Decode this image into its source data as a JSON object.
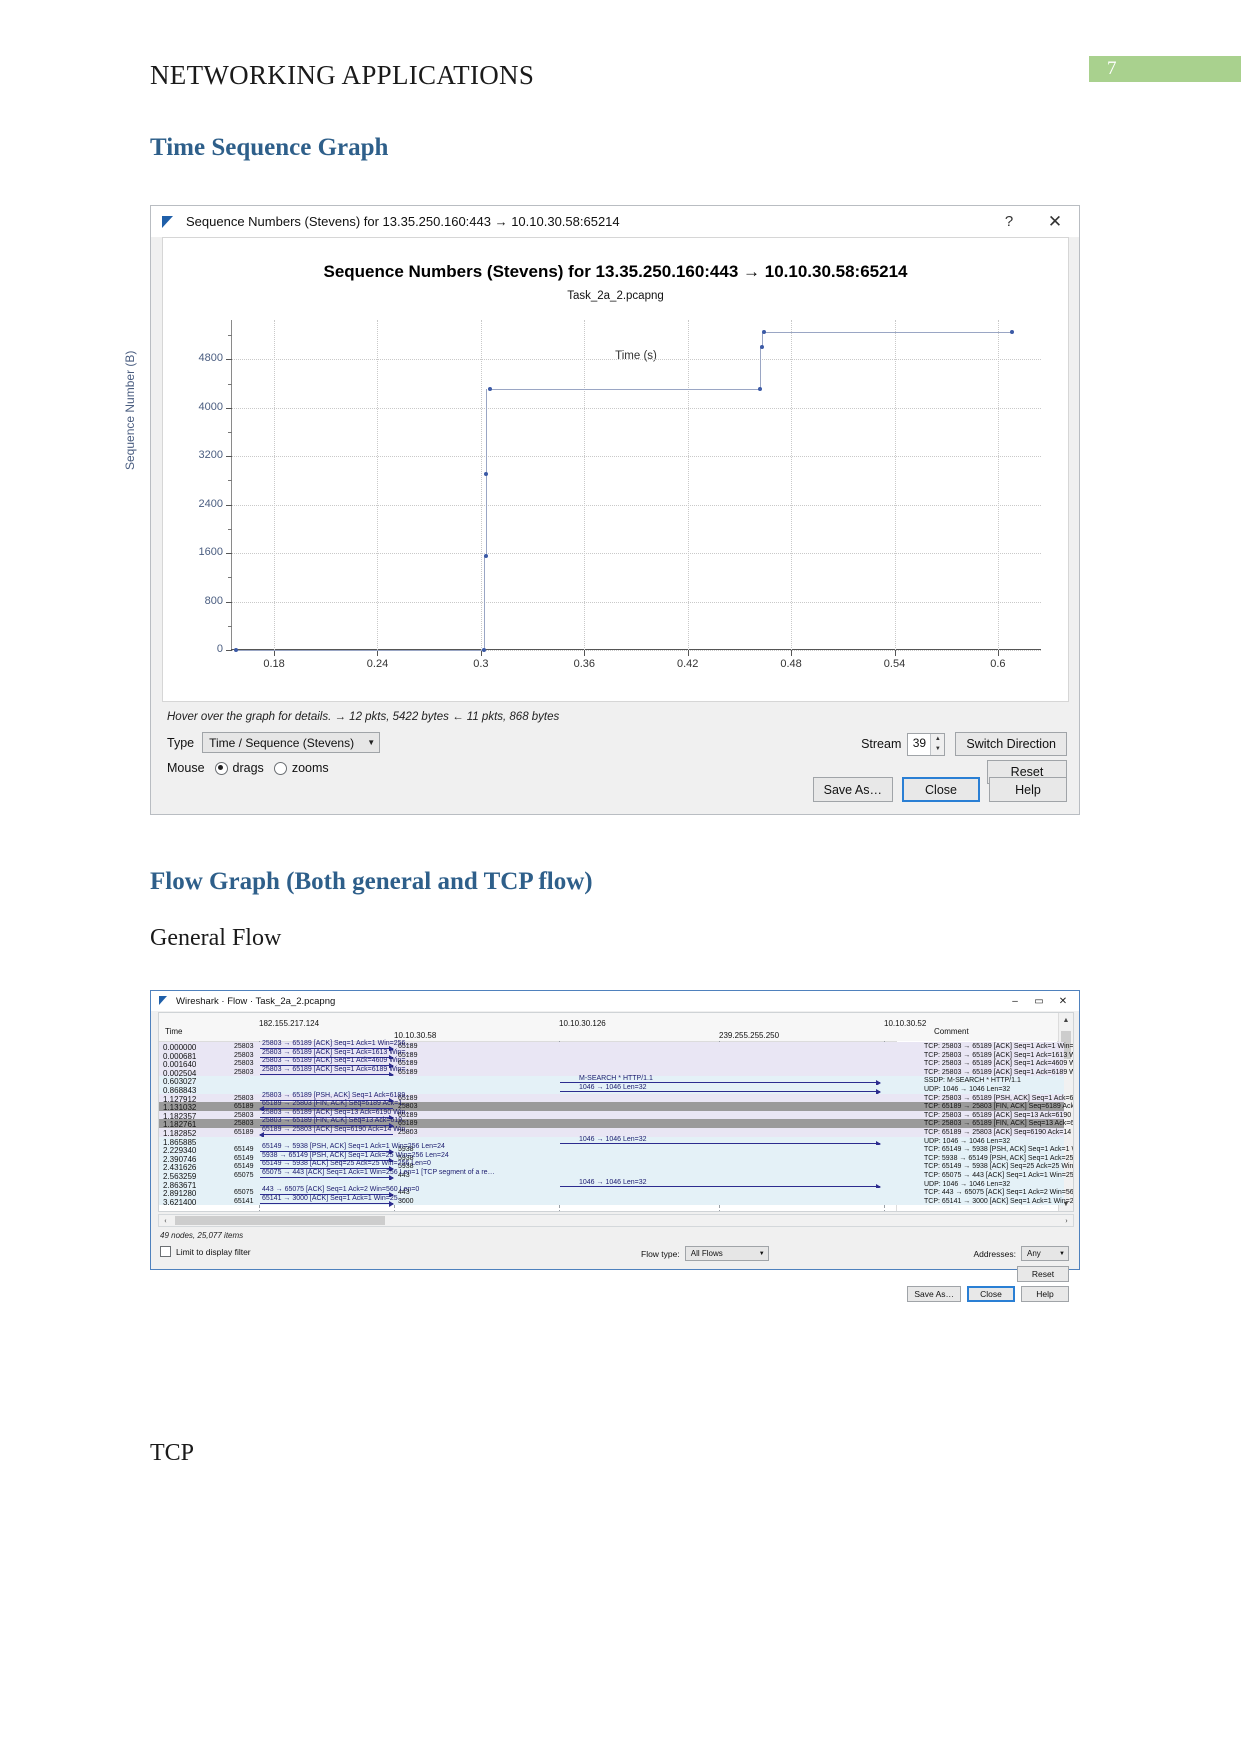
{
  "document": {
    "header_title": "NETWORKING APPLICATIONS",
    "page_number": "7",
    "page_badge_color": "#a9d18e",
    "heading_color": "#2e5f8a",
    "headings": {
      "time_sequence": "Time Sequence Graph",
      "flow_graph": "Flow Graph (Both general and TCP flow)",
      "general_flow": "General Flow",
      "tcp": "TCP"
    }
  },
  "sequence_window": {
    "title": "Sequence Numbers (Stevens) for 13.35.250.160:443 → 10.10.30.58:65214",
    "title_icon": "wireshark-fin-icon",
    "help_icon": "?",
    "close_icon": "✕",
    "chart_title": "Sequence Numbers (Stevens) for 13.35.250.160:443 → 10.10.30.58:65214",
    "chart_subtitle": "Task_2a_2.pcapng",
    "hint": "Hover over the graph for details. → 12 pkts, 5422 bytes ← 11 pkts, 868 bytes",
    "type_label": "Type",
    "type_value": "Time / Sequence (Stevens)",
    "mouse_label": "Mouse",
    "mouse_drags": "drags",
    "mouse_zooms": "zooms",
    "mouse_selected": "drags",
    "stream_label": "Stream",
    "stream_value": "39",
    "switch_direction": "Switch Direction",
    "reset": "Reset",
    "save_as": "Save As…",
    "close": "Close",
    "help": "Help"
  },
  "chart_data": {
    "type": "line",
    "title": "Sequence Numbers (Stevens) for 13.35.250.160:443 → 10.10.30.58:65214",
    "subtitle": "Task_2a_2.pcapng",
    "xlabel": "Time (s)",
    "ylabel": "Sequence Number (B)",
    "xlim": [
      0.155,
      0.625
    ],
    "ylim": [
      0,
      5450
    ],
    "xticks": [
      "0.18",
      "0.24",
      "0.3",
      "0.36",
      "0.42",
      "0.48",
      "0.54",
      "0.6"
    ],
    "xtick_values": [
      0.18,
      0.24,
      0.3,
      0.36,
      0.42,
      0.48,
      0.54,
      0.6
    ],
    "yticks": [
      "0",
      "800",
      "1600",
      "2400",
      "3200",
      "4000",
      "4800"
    ],
    "ytick_values": [
      0,
      800,
      1600,
      2400,
      3200,
      4000,
      4800
    ],
    "grid": true,
    "legend": "none",
    "series": [
      {
        "name": "Sequence numbers (Stevens)",
        "points": [
          {
            "x": 0.158,
            "y": 0
          },
          {
            "x": 0.302,
            "y": 0
          },
          {
            "x": 0.303,
            "y": 1553
          },
          {
            "x": 0.303,
            "y": 2900
          },
          {
            "x": 0.305,
            "y": 4313
          },
          {
            "x": 0.462,
            "y": 4313
          },
          {
            "x": 0.463,
            "y": 5000
          },
          {
            "x": 0.464,
            "y": 5255
          },
          {
            "x": 0.608,
            "y": 5255
          }
        ]
      }
    ]
  },
  "flow_window": {
    "title": "Wireshark · Flow · Task_2a_2.pcapng",
    "title_icon": "wireshark-fin-icon",
    "minimize_icon": "–",
    "maximize_icon": "▭",
    "close_icon": "✕",
    "columns": [
      "Time",
      "182.155.217.124",
      "10.10.30.58",
      "10.10.30.126",
      "239.255.255.250",
      "10.10.30.52",
      "Comment"
    ],
    "status": "49 nodes, 25,077 items",
    "limit_to_display_filter": "Limit to display filter",
    "flow_type_label": "Flow type:",
    "flow_type_value": "All Flows",
    "addresses_label": "Addresses:",
    "addresses_value": "Any",
    "reset": "Reset",
    "save_as": "Save As…",
    "close": "Close",
    "help": "Help",
    "rows": [
      {
        "time": "0.000000",
        "src_port": "25803",
        "dst_port": "65189",
        "label": "25803 → 65189 [ACK] Seq=1 Ack=1 Win=256…",
        "comment": "TCP: 25803 → 65189 [ACK] Seq=1 Ack=1 Win=2…",
        "band": "b1",
        "selected": false
      },
      {
        "time": "0.000681",
        "src_port": "25803",
        "dst_port": "65189",
        "label": "25803 → 65189 [ACK] Seq=1 Ack=1613 Win=…",
        "comment": "TCP: 25803 → 65189 [ACK] Seq=1 Ack=1613 Wi…",
        "band": "b1",
        "selected": false
      },
      {
        "time": "0.001640",
        "src_port": "25803",
        "dst_port": "65189",
        "label": "25803 → 65189 [ACK] Seq=1 Ack=4609 Win=…",
        "comment": "TCP: 25803 → 65189 [ACK] Seq=1 Ack=4609 Wi…",
        "band": "b1",
        "selected": false
      },
      {
        "time": "0.002504",
        "src_port": "25803",
        "dst_port": "65189",
        "label": "25803 → 65189 [ACK] Seq=1 Ack=6189 Win=…",
        "comment": "TCP: 25803 → 65189 [ACK] Seq=1 Ack=6189 Wi…",
        "band": "b1",
        "selected": false
      },
      {
        "time": "0.603027",
        "src_port": "",
        "dst_port": "",
        "label": "M-SEARCH * HTTP/1.1",
        "comment": "SSDP: M-SEARCH * HTTP/1.1",
        "band": "b2",
        "selected": false
      },
      {
        "time": "0.868843",
        "src_port": "",
        "dst_port": "",
        "label": "1046 → 1046 Len=32",
        "comment": "UDP: 1046 → 1046 Len=32",
        "band": "b2",
        "selected": false
      },
      {
        "time": "1.127912",
        "src_port": "25803",
        "dst_port": "65189",
        "label": "25803 → 65189 [PSH, ACK] Seq=1 Ack=6189…",
        "comment": "TCP: 25803 → 65189 [PSH, ACK] Seq=1 Ack=61…",
        "band": "b1",
        "selected": false
      },
      {
        "time": "1.131032",
        "src_port": "65189",
        "dst_port": "25803",
        "label": "65189 → 25803 [FIN, ACK] Seq=6189 Ack=1…",
        "comment": "TCP: 65189 → 25803 [FIN, ACK] Seq=6189 Ack…",
        "band": "b1",
        "selected": true
      },
      {
        "time": "1.182357",
        "src_port": "25803",
        "dst_port": "65189",
        "label": "25803 → 65189 [ACK] Seq=13 Ack=6190 Win…",
        "comment": "TCP: 25803 → 65189 [ACK] Seq=13 Ack=6190 W…",
        "band": "b1",
        "selected": false
      },
      {
        "time": "1.182761",
        "src_port": "25803",
        "dst_port": "65189",
        "label": "25803 → 65189 [FIN, ACK] Seq=13 Ack=619…",
        "comment": "TCP: 25803 → 65189 [FIN, ACK] Seq=13 Ack=6…",
        "band": "b1",
        "selected": true
      },
      {
        "time": "1.182852",
        "src_port": "65189",
        "dst_port": "25803",
        "label": "65189 → 25803 [ACK] Seq=6190 Ack=14 Win…",
        "comment": "TCP: 65189 → 25803 [ACK] Seq=6190 Ack=14 W…",
        "band": "b1",
        "selected": false
      },
      {
        "time": "1.865885",
        "src_port": "",
        "dst_port": "",
        "label": "1046 → 1046 Len=32",
        "comment": "UDP: 1046 → 1046 Len=32",
        "band": "b2",
        "selected": false
      },
      {
        "time": "2.229340",
        "src_port": "65149",
        "dst_port": "5938",
        "label": "65149 → 5938 [PSH, ACK] Seq=1 Ack=1 Win=256 Len=24",
        "comment": "TCP: 65149 → 5938 [PSH, ACK] Seq=1 Ack=1 W…",
        "band": "b2",
        "selected": false
      },
      {
        "time": "2.390746",
        "src_port": "65149",
        "dst_port": "5938",
        "label": "5938 → 65149 [PSH, ACK] Seq=1 Ack=25 Win=256 Len=24",
        "comment": "TCP: 5938 → 65149 [PSH, ACK] Seq=1 Ack=25 …",
        "band": "b2",
        "selected": false
      },
      {
        "time": "2.431626",
        "src_port": "65149",
        "dst_port": "5938",
        "label": "65149 → 5938 [ACK] Seq=25 Ack=25 Win=256 Len=0",
        "comment": "TCP: 65149 → 5938 [ACK] Seq=25 Ack=25 Win=…",
        "band": "b2",
        "selected": false
      },
      {
        "time": "2.563259",
        "src_port": "65075",
        "dst_port": "443",
        "label": "65075 → 443 [ACK] Seq=1 Ack=1 Win=256 Len=1 [TCP segment of a re…",
        "comment": "TCP: 65075 → 443 [ACK] Seq=1 Ack=1 Win=256…",
        "band": "b2",
        "selected": false
      },
      {
        "time": "2.863671",
        "src_port": "",
        "dst_port": "",
        "label": "1046 → 1046 Len=32",
        "comment": "UDP: 1046 → 1046 Len=32",
        "band": "b2",
        "selected": false
      },
      {
        "time": "2.891280",
        "src_port": "65075",
        "dst_port": "443",
        "label": "443 → 65075 [ACK] Seq=1 Ack=2 Win=560 Len=0",
        "comment": "TCP: 443 → 65075 [ACK] Seq=1 Ack=2 Win=560…",
        "band": "b2",
        "selected": false
      },
      {
        "time": "3.621400",
        "src_port": "65141",
        "dst_port": "3000",
        "label": "65141 → 3000 [ACK] Seq=1 Ack=1 Win=25…",
        "comment": "TCP: 65141 → 3000 [ACK] Seq=1 Ack=1 Win=25…",
        "band": "b2",
        "selected": false
      }
    ]
  }
}
